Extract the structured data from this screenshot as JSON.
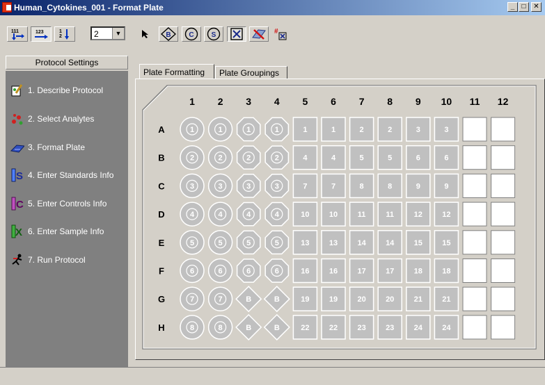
{
  "window": {
    "title": "Human_Cytokines_001 - Format Plate"
  },
  "toolbar": {
    "replicate_value": "2",
    "buttons": [
      {
        "name": "number-down-icon",
        "glyph": "111"
      },
      {
        "name": "number-right-icon",
        "glyph": "123"
      },
      {
        "name": "number-column-icon",
        "glyph": "1 2"
      }
    ],
    "mode_buttons": [
      {
        "name": "pointer-icon",
        "glyph": "➤"
      },
      {
        "name": "blank-diamond-icon",
        "glyph": "B"
      },
      {
        "name": "control-circle-icon",
        "glyph": "C"
      },
      {
        "name": "standard-circle-icon",
        "glyph": "S"
      },
      {
        "name": "sample-x-icon",
        "glyph": "✕"
      },
      {
        "name": "clear-wells-icon",
        "glyph": "✗"
      },
      {
        "name": "numbered-clear-icon",
        "glyph": "#"
      }
    ]
  },
  "sidebar": {
    "title": "Protocol Settings",
    "steps": [
      {
        "label": "1. Describe Protocol",
        "icon": "describe-protocol-icon"
      },
      {
        "label": "2. Select Analytes",
        "icon": "select-analytes-icon"
      },
      {
        "label": "3. Format Plate",
        "icon": "format-plate-icon"
      },
      {
        "label": "4. Enter Standards Info",
        "icon": "standards-icon"
      },
      {
        "label": "5. Enter Controls Info",
        "icon": "controls-icon"
      },
      {
        "label": "6. Enter Sample Info",
        "icon": "samples-icon"
      },
      {
        "label": "7. Run Protocol",
        "icon": "run-protocol-icon"
      }
    ]
  },
  "tabs": [
    {
      "label": "Plate Formatting",
      "active": true
    },
    {
      "label": "Plate Groupings",
      "active": false
    }
  ],
  "plate": {
    "columns": [
      "1",
      "2",
      "3",
      "4",
      "5",
      "6",
      "7",
      "8",
      "9",
      "10",
      "11",
      "12"
    ],
    "rows": [
      "A",
      "B",
      "C",
      "D",
      "E",
      "F",
      "G",
      "H"
    ],
    "wells": [
      [
        "1",
        "1",
        "1",
        "1",
        "1",
        "1",
        "2",
        "2",
        "3",
        "3",
        "",
        ""
      ],
      [
        "2",
        "2",
        "2",
        "2",
        "4",
        "4",
        "5",
        "5",
        "6",
        "6",
        "",
        ""
      ],
      [
        "3",
        "3",
        "3",
        "3",
        "7",
        "7",
        "8",
        "8",
        "9",
        "9",
        "",
        ""
      ],
      [
        "4",
        "4",
        "4",
        "4",
        "10",
        "10",
        "11",
        "11",
        "12",
        "12",
        "",
        ""
      ],
      [
        "5",
        "5",
        "5",
        "5",
        "13",
        "13",
        "14",
        "14",
        "15",
        "15",
        "",
        ""
      ],
      [
        "6",
        "6",
        "6",
        "6",
        "16",
        "16",
        "17",
        "17",
        "18",
        "18",
        "",
        ""
      ],
      [
        "7",
        "7",
        "B",
        "B",
        "19",
        "19",
        "20",
        "20",
        "21",
        "21",
        "",
        ""
      ],
      [
        "8",
        "8",
        "B",
        "B",
        "22",
        "22",
        "23",
        "23",
        "24",
        "24",
        "",
        ""
      ]
    ],
    "well_types": [
      [
        "S",
        "S",
        "C",
        "C",
        "X",
        "X",
        "X",
        "X",
        "X",
        "X",
        "E",
        "E"
      ],
      [
        "S",
        "S",
        "C",
        "C",
        "X",
        "X",
        "X",
        "X",
        "X",
        "X",
        "E",
        "E"
      ],
      [
        "S",
        "S",
        "C",
        "C",
        "X",
        "X",
        "X",
        "X",
        "X",
        "X",
        "E",
        "E"
      ],
      [
        "S",
        "S",
        "C",
        "C",
        "X",
        "X",
        "X",
        "X",
        "X",
        "X",
        "E",
        "E"
      ],
      [
        "S",
        "S",
        "C",
        "C",
        "X",
        "X",
        "X",
        "X",
        "X",
        "X",
        "E",
        "E"
      ],
      [
        "S",
        "S",
        "C",
        "C",
        "X",
        "X",
        "X",
        "X",
        "X",
        "X",
        "E",
        "E"
      ],
      [
        "S",
        "S",
        "B",
        "B",
        "X",
        "X",
        "X",
        "X",
        "X",
        "X",
        "E",
        "E"
      ],
      [
        "S",
        "S",
        "B",
        "B",
        "X",
        "X",
        "X",
        "X",
        "X",
        "X",
        "E",
        "E"
      ]
    ]
  },
  "colors": {
    "sidebar_bg": "#808080",
    "well_fill": "#c0c0c0",
    "well_empty": "#ffffff",
    "titlebar": "#0a246a"
  }
}
